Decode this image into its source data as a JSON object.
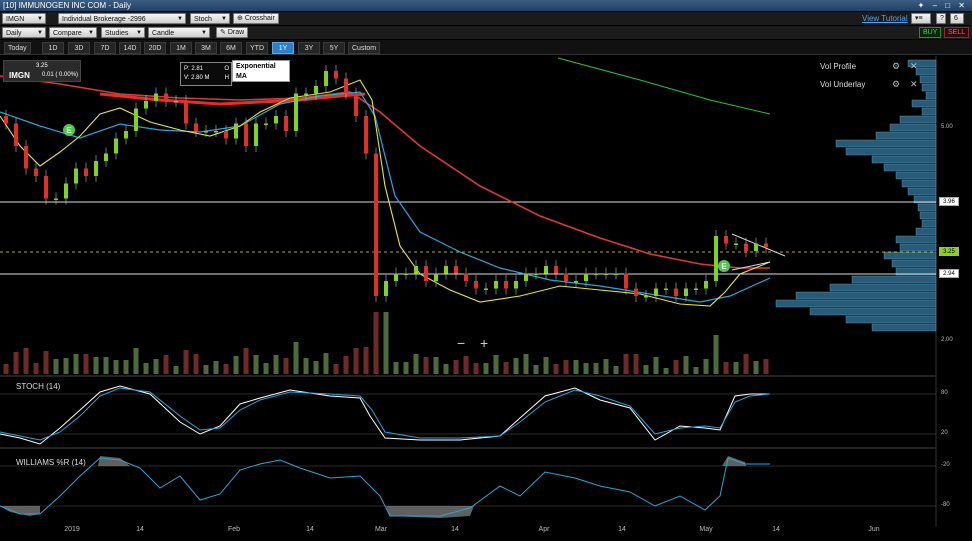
{
  "window": {
    "title": "[10] IMMUNOGEN INC COM - Daily",
    "controls": "✦ – □ ✕"
  },
  "toolbar1": {
    "symbol": "IMGN",
    "account": "Individual Brokerage -2996",
    "indicator": "Stoch",
    "crosshair": "Crosshair",
    "tutorial": "View Tutorial",
    "help": "?",
    "count": "6"
  },
  "toolbar2": {
    "period": "Daily",
    "compare": "Compare",
    "studies": "Studies",
    "style": "Candle",
    "draw": "Draw",
    "buy": "BUY",
    "sell": "SELL"
  },
  "ranges": [
    "Today",
    "1D",
    "3D",
    "7D",
    "14D",
    "20D",
    "1M",
    "3M",
    "6M",
    "YTD",
    "1Y",
    "3Y",
    "5Y",
    "Custom"
  ],
  "active_range": "1Y",
  "info": {
    "symbol": "IMGN",
    "price": "3.25",
    "change": "0.01 ( 0.00%)"
  },
  "tooltip": {
    "p": "P: 2.81",
    "v": "V: 2.80 M",
    "o": "O",
    "h": "H"
  },
  "ma_tip": {
    "title": "Exponential MA",
    "sub": "(right-click to manage)"
  },
  "overlays": [
    "Vol Profile",
    "Vol Underlay"
  ],
  "indicators": {
    "stoch": "STOCH (14)",
    "williams": "WILLIAMS %R (14)"
  },
  "zoom": {
    "minus": "−",
    "plus": "+"
  },
  "earnings_marker": "E",
  "x_labels": [
    "2019",
    "14",
    "Feb",
    "14",
    "Mar",
    "14",
    "Apr",
    "14",
    "May",
    "14",
    "Jun"
  ],
  "y_labels": [
    "5.00",
    "2.00"
  ],
  "stoch_levels": [
    "80",
    "20"
  ],
  "williams_levels": [
    "-20",
    "-80"
  ],
  "price_tags": {
    "top": "3.96",
    "current": "3.25",
    "low": "2.94"
  },
  "colors": {
    "up": "#7ed321",
    "down": "#e0302a",
    "ema_fast": "#e8e24a",
    "ema_mid": "#2fa3d8",
    "ema_slow": "#d83a3a",
    "ema_long": "#27c23a",
    "volume_profile": "#2f6b8c"
  },
  "chart_data": {
    "type": "candlestick",
    "symbol": "IMGN",
    "period": "Daily",
    "ylim": [
      1.8,
      5.8
    ],
    "close": [
      4.9,
      4.6,
      4.3,
      4.2,
      3.9,
      3.9,
      4.1,
      4.3,
      4.2,
      4.4,
      4.5,
      4.7,
      4.8,
      5.1,
      5.2,
      5.3,
      5.2,
      5.2,
      4.9,
      4.8,
      4.8,
      4.8,
      4.7,
      4.9,
      4.6,
      4.9,
      4.9,
      5.0,
      4.8,
      5.3,
      5.3,
      5.4,
      5.6,
      5.5,
      5.3,
      5.0,
      4.5,
      2.6,
      2.8,
      2.9,
      2.9,
      3.0,
      2.8,
      2.9,
      3.0,
      2.9,
      2.8,
      2.7,
      2.7,
      2.8,
      2.7,
      2.8,
      2.9,
      2.9,
      3.0,
      2.9,
      2.8,
      2.8,
      2.9,
      2.9,
      2.9,
      2.9,
      2.7,
      2.6,
      2.6,
      2.7,
      2.7,
      2.6,
      2.7,
      2.7,
      2.8,
      3.4,
      3.3,
      3.3,
      3.2,
      3.3,
      3.25
    ],
    "volume_scale": "relative",
    "stoch": {
      "levels": [
        80,
        20
      ]
    },
    "williams": {
      "levels": [
        -20,
        -80
      ]
    }
  }
}
